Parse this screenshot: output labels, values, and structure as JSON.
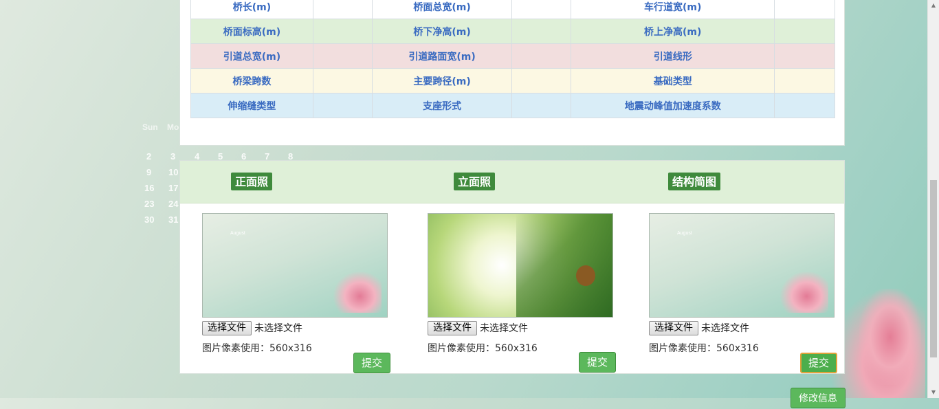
{
  "background": {
    "calendar_days": "Sun Mo",
    "calendar_numbers": [
      "2",
      "3",
      "4",
      "5",
      "6",
      "7",
      "8",
      "9",
      "10",
      "16",
      "17",
      "23",
      "24",
      "30",
      "31"
    ]
  },
  "table": {
    "rows": [
      {
        "label_1": "桥长(m)",
        "label_2": "桥面总宽(m)",
        "label_3": "车行道宽(m)"
      },
      {
        "label_1": "桥面标高(m)",
        "label_2": "桥下净高(m)",
        "label_3": "桥上净高(m)"
      },
      {
        "label_1": "引道总宽(m)",
        "label_2": "引道路面宽(m)",
        "label_3": "引道线形"
      },
      {
        "label_1": "桥梁跨数",
        "label_2": "主要跨径(m)",
        "label_3": "基础类型"
      },
      {
        "label_1": "伸缩缝类型",
        "label_2": "支座形式",
        "label_3": "地震动峰值加速度系数"
      }
    ]
  },
  "photos": {
    "sections": [
      {
        "title": "正面照",
        "file_button": "选择文件",
        "file_status": "未选择文件",
        "hint": "图片像素使用：560x316",
        "submit": "提交",
        "calendar_text": "August"
      },
      {
        "title": "立面照",
        "file_button": "选择文件",
        "file_status": "未选择文件",
        "hint": "图片像素使用：560x316",
        "submit": "提交"
      },
      {
        "title": "结构简图",
        "file_button": "选择文件",
        "file_status": "未选择文件",
        "hint": "图片像素使用：560x316",
        "submit": "提交",
        "calendar_text": "August"
      }
    ]
  },
  "footer": {
    "modify_button": "修改信息"
  },
  "colors": {
    "accent_green": "#5cb85c",
    "title_green": "#3f8a3c",
    "label_blue": "#3a6bc1"
  }
}
